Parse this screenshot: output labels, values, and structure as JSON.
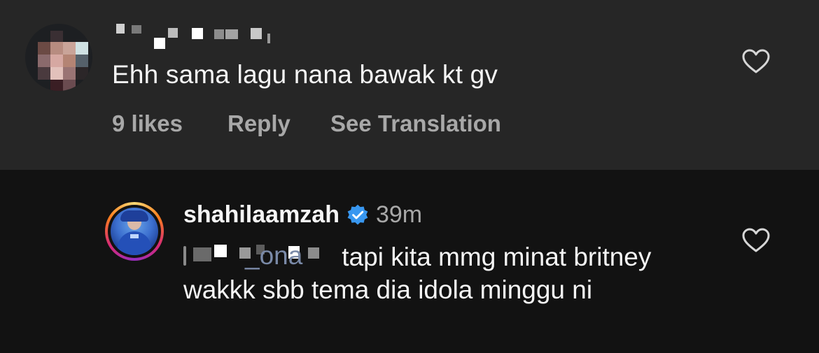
{
  "comment": {
    "text": "Ehh sama lagu nana bawak kt gv",
    "likes": "9 likes",
    "reply": "Reply",
    "see_translation": "See Translation"
  },
  "reply": {
    "username": "shahilaamzah",
    "time": "39m",
    "mention_suffix": "_ona",
    "text": "tapi kita mmg minat britney wakkk sbb tema dia idola minggu ni"
  },
  "colors": {
    "top_background": "#262626",
    "bottom_background": "#121212",
    "primary_text": "#f5f5f5",
    "secondary_text": "#a8a8a8",
    "verified_blue": "#3897f0"
  },
  "icons": {
    "like": "heart-outline-icon",
    "verified": "verified-badge-icon"
  }
}
